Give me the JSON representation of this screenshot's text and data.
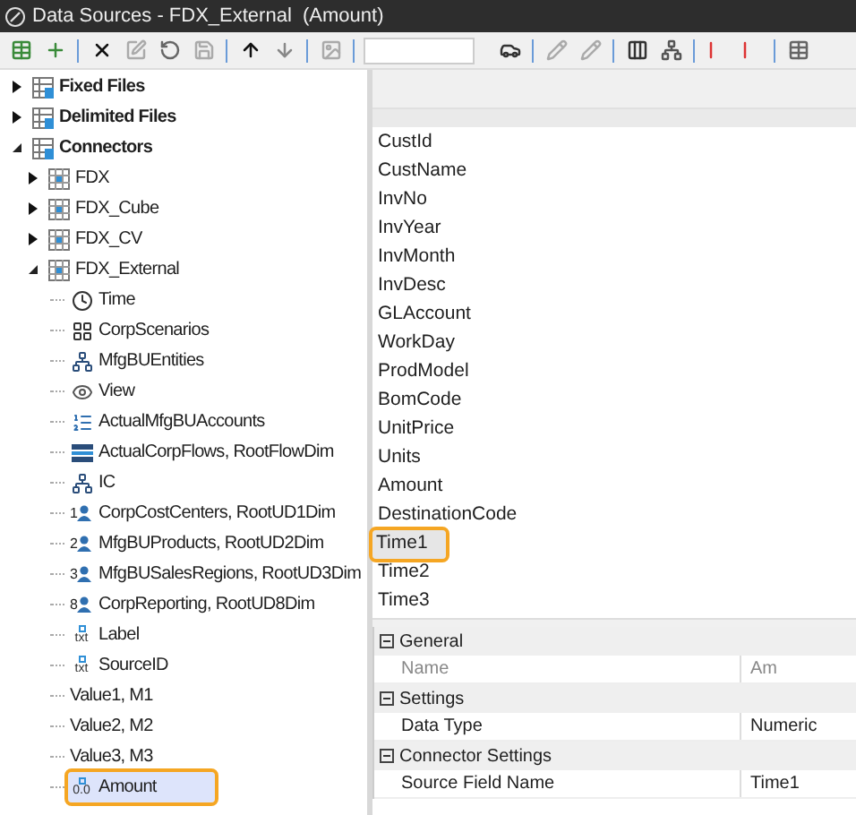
{
  "window": {
    "title": "Data Sources - FDX_External  (Amount)"
  },
  "tree": [
    {
      "label": "Fixed Files",
      "kind": "group",
      "expanded": false,
      "selected": false,
      "highlighted": false
    },
    {
      "label": "Delimited Files",
      "kind": "group",
      "expanded": false,
      "selected": false,
      "highlighted": false
    },
    {
      "label": "Connectors",
      "kind": "group",
      "expanded": true,
      "selected": false,
      "highlighted": false,
      "children": [
        {
          "label": "FDX",
          "kind": "connector",
          "expanded": false,
          "selected": false,
          "highlighted": false
        },
        {
          "label": "FDX_Cube",
          "kind": "connector",
          "expanded": false,
          "selected": false,
          "highlighted": false
        },
        {
          "label": "FDX_CV",
          "kind": "connector",
          "expanded": false,
          "selected": false,
          "highlighted": false
        },
        {
          "label": "FDX_External",
          "kind": "connector",
          "expanded": true,
          "selected": false,
          "highlighted": false,
          "children": [
            {
              "label": "Time",
              "kind": "time",
              "selected": false,
              "highlighted": false
            },
            {
              "label": "CorpScenarios",
              "kind": "scenario",
              "selected": false,
              "highlighted": false
            },
            {
              "label": "MfgBUEntities",
              "kind": "entity",
              "selected": false,
              "highlighted": false
            },
            {
              "label": "View",
              "kind": "view",
              "selected": false,
              "highlighted": false
            },
            {
              "label": "ActualMfgBUAccounts",
              "kind": "account",
              "selected": false,
              "highlighted": false
            },
            {
              "label": "ActualCorpFlows, RootFlowDim",
              "kind": "flow",
              "selected": false,
              "highlighted": false
            },
            {
              "label": "IC",
              "kind": "entity",
              "selected": false,
              "highlighted": false
            },
            {
              "label": "CorpCostCenters, RootUD1Dim",
              "kind": "ud",
              "badge": "1",
              "selected": false,
              "highlighted": false
            },
            {
              "label": "MfgBUProducts, RootUD2Dim",
              "kind": "ud",
              "badge": "2",
              "selected": false,
              "highlighted": false
            },
            {
              "label": "MfgBUSalesRegions, RootUD3Dim",
              "kind": "ud",
              "badge": "3",
              "selected": false,
              "highlighted": false
            },
            {
              "label": "CorpReporting, RootUD8Dim",
              "kind": "ud",
              "badge": "8",
              "selected": false,
              "highlighted": false
            },
            {
              "label": "Label",
              "kind": "text",
              "badge": "txt",
              "selected": false,
              "highlighted": false
            },
            {
              "label": "SourceID",
              "kind": "text",
              "badge": "txt",
              "selected": false,
              "highlighted": false
            },
            {
              "label": "Value1, M1",
              "kind": "value",
              "selected": false,
              "highlighted": false
            },
            {
              "label": "Value2, M2",
              "kind": "value",
              "selected": false,
              "highlighted": false
            },
            {
              "label": "Value3, M3",
              "kind": "value",
              "selected": false,
              "highlighted": false
            },
            {
              "label": "Amount",
              "kind": "amount",
              "badge": "0.0",
              "selected": true,
              "highlighted": true
            }
          ]
        }
      ]
    }
  ],
  "fields": [
    {
      "label": "CustId",
      "selected": false,
      "highlighted": false
    },
    {
      "label": "CustName",
      "selected": false,
      "highlighted": false
    },
    {
      "label": "InvNo",
      "selected": false,
      "highlighted": false
    },
    {
      "label": "InvYear",
      "selected": false,
      "highlighted": false
    },
    {
      "label": "InvMonth",
      "selected": false,
      "highlighted": false
    },
    {
      "label": "InvDesc",
      "selected": false,
      "highlighted": false
    },
    {
      "label": "GLAccount",
      "selected": false,
      "highlighted": false
    },
    {
      "label": "WorkDay",
      "selected": false,
      "highlighted": false
    },
    {
      "label": "ProdModel",
      "selected": false,
      "highlighted": false
    },
    {
      "label": "BomCode",
      "selected": false,
      "highlighted": false
    },
    {
      "label": "UnitPrice",
      "selected": false,
      "highlighted": false
    },
    {
      "label": "Units",
      "selected": false,
      "highlighted": false
    },
    {
      "label": "Amount",
      "selected": false,
      "highlighted": false
    },
    {
      "label": "DestinationCode",
      "selected": false,
      "highlighted": false
    },
    {
      "label": "Time1",
      "selected": true,
      "highlighted": true
    },
    {
      "label": "Time2",
      "selected": false,
      "highlighted": false
    },
    {
      "label": "Time3",
      "selected": false,
      "highlighted": false
    }
  ],
  "properties": [
    {
      "category": "General",
      "expanded": true,
      "rows": [
        {
          "name": "Name",
          "value": "Am",
          "disabled": true
        }
      ]
    },
    {
      "category": "Settings",
      "expanded": true,
      "rows": [
        {
          "name": "Data Type",
          "value": "Numeric",
          "disabled": false
        }
      ]
    },
    {
      "category": "Connector Settings",
      "expanded": true,
      "rows": [
        {
          "name": "Source Field Name",
          "value": "Time1",
          "disabled": false
        }
      ]
    }
  ]
}
